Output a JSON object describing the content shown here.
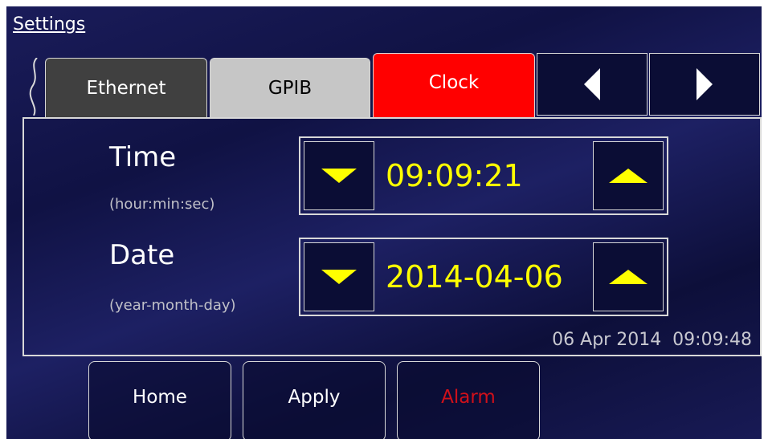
{
  "header": {
    "title": "Settings"
  },
  "tabs": [
    {
      "label": "Ethernet"
    },
    {
      "label": "GPIB"
    },
    {
      "label": "Clock"
    }
  ],
  "clock": {
    "time": {
      "label": "Time",
      "hint": "(hour:min:sec)",
      "value": "09:09:21"
    },
    "date": {
      "label": "Date",
      "hint": "(year-month-day)",
      "value": "2014-04-06"
    },
    "status": "06 Apr 2014  09:09:48"
  },
  "buttons": {
    "home": "Home",
    "apply": "Apply",
    "alarm": "Alarm"
  },
  "colors": {
    "active_tab": "#ff0000",
    "value_text": "#ffff00",
    "alarm_text": "#d0101a",
    "background": "#12144a"
  }
}
